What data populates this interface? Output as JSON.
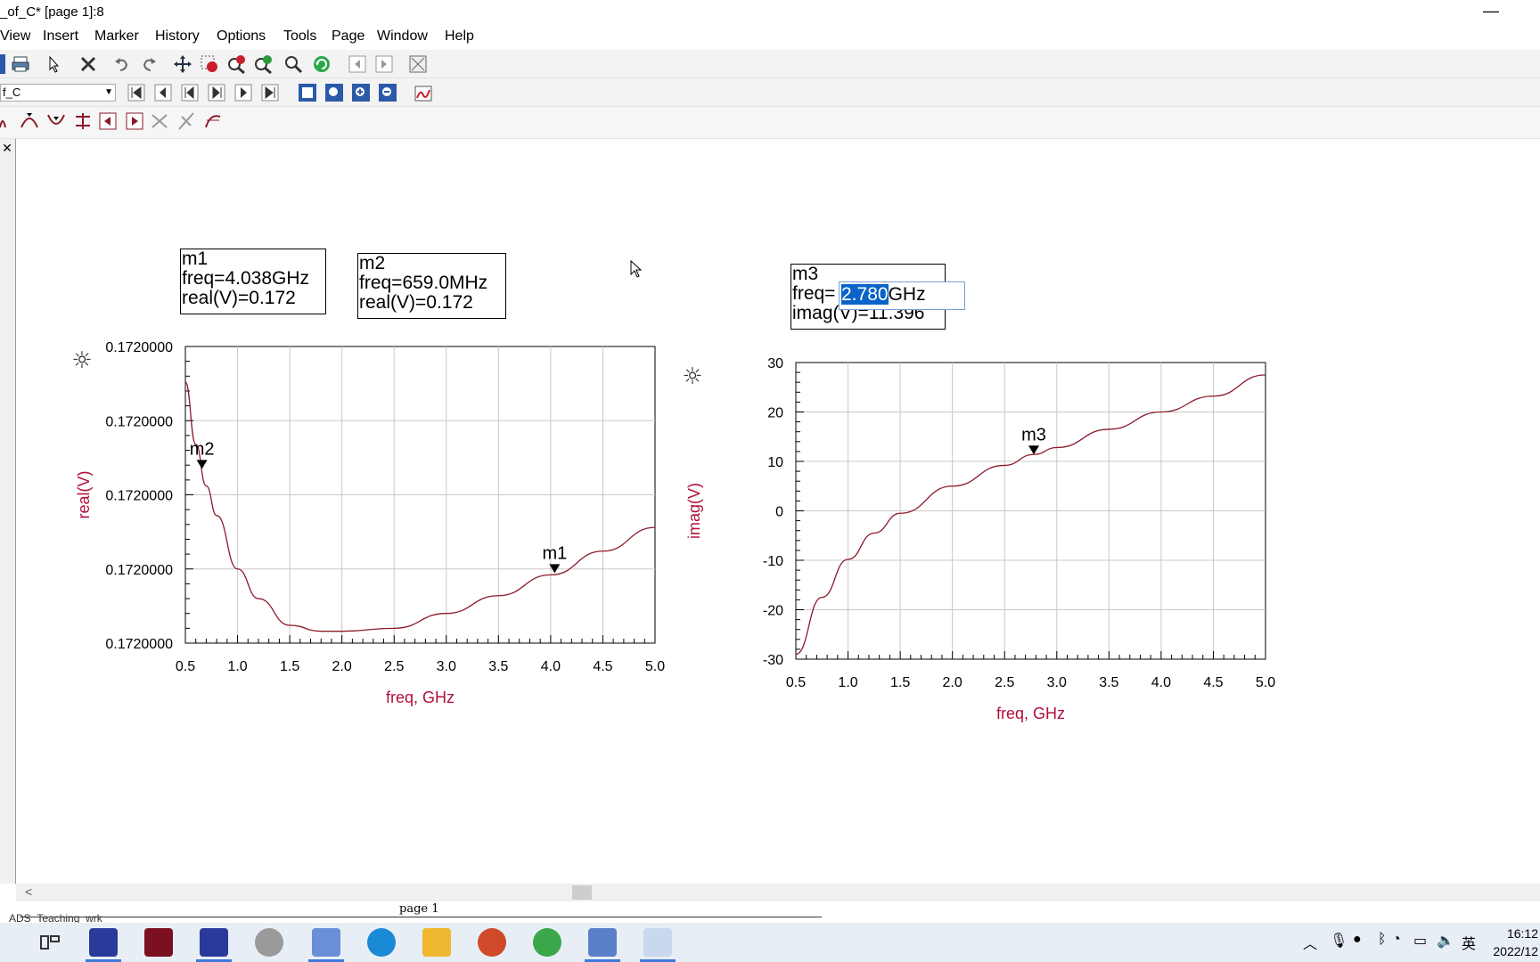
{
  "window": {
    "title": "_of_C* [page 1]:8",
    "minimize_glyph": "—"
  },
  "menu": [
    "View",
    "Insert",
    "Marker",
    "History",
    "Options",
    "Tools",
    "Page",
    "Window",
    "Help"
  ],
  "toolbar": {
    "dataset_combo_value": "f_C"
  },
  "markers": {
    "m1": {
      "name": "m1",
      "line1": "freq=4.038GHz",
      "line2": "real(V)=0.172"
    },
    "m2": {
      "name": "m2",
      "line1": "freq=659.0MHz",
      "line2": "real(V)=0.172"
    },
    "m3": {
      "name": "m3",
      "freq_label": "freq=",
      "edit_selected": "2.780",
      "edit_unit": "GHz",
      "line2": "imag(V)=11.396"
    }
  },
  "colors": {
    "trace": "#8b1a2a",
    "axis_label": "#b0103a",
    "grid": "#c8c8c8",
    "selection": "#0a64c8"
  },
  "chart_data": [
    {
      "type": "line",
      "xlabel": "freq, GHz",
      "ylabel": "real(V)",
      "xlim": [
        0.5,
        5.0
      ],
      "x_ticks": [
        "0.5",
        "1.0",
        "1.5",
        "2.0",
        "2.5",
        "3.0",
        "3.5",
        "4.0",
        "4.5",
        "5.0"
      ],
      "y_ticks": [
        "0.1720000",
        "0.1720000",
        "0.1720000",
        "0.1720000",
        "0.1720000"
      ],
      "grid": true,
      "series": [
        {
          "x": [
            0.5,
            0.6,
            0.7,
            0.8,
            1.0,
            1.2,
            1.5,
            1.8,
            2.0,
            2.5,
            3.0,
            3.5,
            4.0,
            4.5,
            5.0
          ],
          "y_rel": [
            0.88,
            0.67,
            0.53,
            0.43,
            0.25,
            0.15,
            0.06,
            0.04,
            0.04,
            0.05,
            0.1,
            0.16,
            0.23,
            0.31,
            0.39
          ]
        }
      ],
      "markers": [
        {
          "name": "m2",
          "x": 0.659
        },
        {
          "name": "m1",
          "x": 4.038
        }
      ]
    },
    {
      "type": "line",
      "xlabel": "freq, GHz",
      "ylabel": "imag(V)",
      "xlim": [
        0.5,
        5.0
      ],
      "ylim": [
        -30,
        30
      ],
      "x_ticks": [
        "0.5",
        "1.0",
        "1.5",
        "2.0",
        "2.5",
        "3.0",
        "3.5",
        "4.0",
        "4.5",
        "5.0"
      ],
      "y_ticks": [
        "-30",
        "-20",
        "-10",
        "0",
        "10",
        "20",
        "30"
      ],
      "grid": true,
      "series": [
        {
          "x": [
            0.5,
            0.75,
            1.0,
            1.25,
            1.5,
            2.0,
            2.5,
            2.78,
            3.0,
            3.5,
            4.0,
            4.5,
            5.0
          ],
          "y": [
            -29,
            -17.5,
            -9.8,
            -4.5,
            -0.5,
            5,
            9.2,
            11.396,
            12.8,
            16.5,
            20,
            23.2,
            27.5
          ]
        }
      ],
      "markers": [
        {
          "name": "m3",
          "x": 2.78,
          "y": 11.396
        }
      ]
    }
  ],
  "page_tab": "page 1",
  "status": " _ADS_Teaching_wrk",
  "tray": {
    "ime": "英",
    "time": "16:12",
    "date": "2022/12"
  }
}
